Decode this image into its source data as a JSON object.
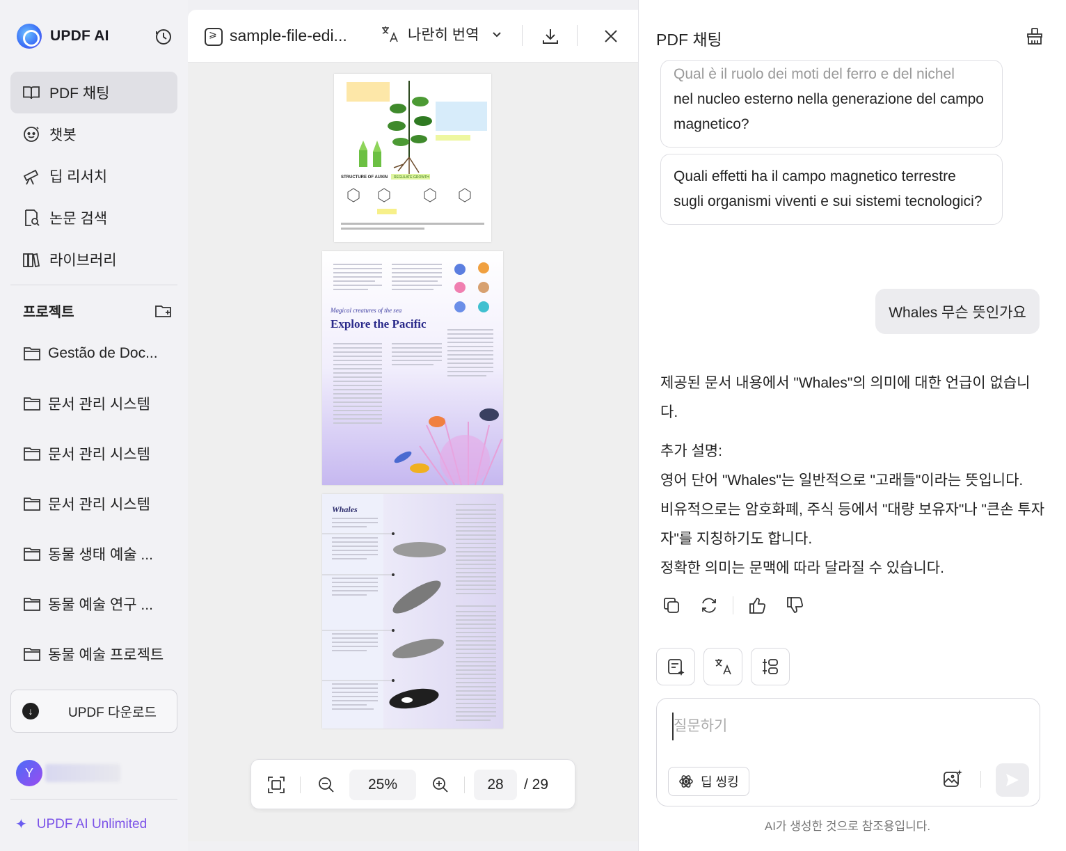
{
  "sidebar": {
    "brand": "UPDF AI",
    "nav": [
      {
        "label": "PDF 채팅",
        "icon": "book-open-icon",
        "active": true
      },
      {
        "label": "챗봇",
        "icon": "chatbot-icon",
        "active": false
      },
      {
        "label": "딥 리서치",
        "icon": "telescope-icon",
        "active": false
      },
      {
        "label": "논문 검색",
        "icon": "paper-search-icon",
        "active": false
      },
      {
        "label": "라이브러리",
        "icon": "library-icon",
        "active": false
      }
    ],
    "projects_title": "프로젝트",
    "projects": [
      "Gestão de Doc...",
      "문서 관리 시스템",
      "문서 관리 시스템",
      "문서 관리 시스템",
      "동물 생태 예술 ...",
      "동물 예술 연구 ...",
      "동물 예술 프로젝트"
    ],
    "download_label": "UPDF 다운로드",
    "avatar_letter": "Y",
    "unlimited_label": "UPDF AI Unlimited"
  },
  "viewer": {
    "file_name": "sample-file-edi...",
    "translate_label": "나란히 번역",
    "zoom": "25%",
    "current_page": "28",
    "page_total": "/ 29",
    "page1": {
      "title": "STRUCTURE OF AUXIN",
      "badge": "REGULATE GROWTH"
    },
    "page2": {
      "subtitle": "Magical creatures of the sea",
      "title": "Explore the Pacific"
    },
    "page3": {
      "title": "Whales"
    }
  },
  "chat": {
    "title": "PDF 채팅",
    "suggestions": [
      {
        "faded": "Qual è il ruolo dei moti del ferro e del nichel",
        "text": "nel nucleo esterno nella generazione del campo magnetico?"
      },
      {
        "faded": "",
        "text": "Quali effetti ha il campo magnetico terrestre sugli organismi viventi e sui sistemi tecnologici?"
      }
    ],
    "user_message": "Whales 무슨 뜻인가요",
    "answer": {
      "line1": "제공된 문서 내용에서 \"Whales\"의 의미에 대한 언급이 없습니다.",
      "extra_title": "추가 설명:",
      "line2": "영어 단어 \"Whales\"는 일반적으로 \"고래들\"이라는 뜻입니다.",
      "line3": "비유적으로는 암호화폐, 주식 등에서 \"대량 보유자\"나 \"큰손 투자자\"를 지칭하기도 합니다.",
      "line4": "정확한 의미는 문맥에 따라 달라질 수 있습니다."
    },
    "input_placeholder": "질문하기",
    "deep_thinking_label": "딥 씽킹",
    "disclaimer": "AI가 생성한 것으로 참조용입니다."
  }
}
